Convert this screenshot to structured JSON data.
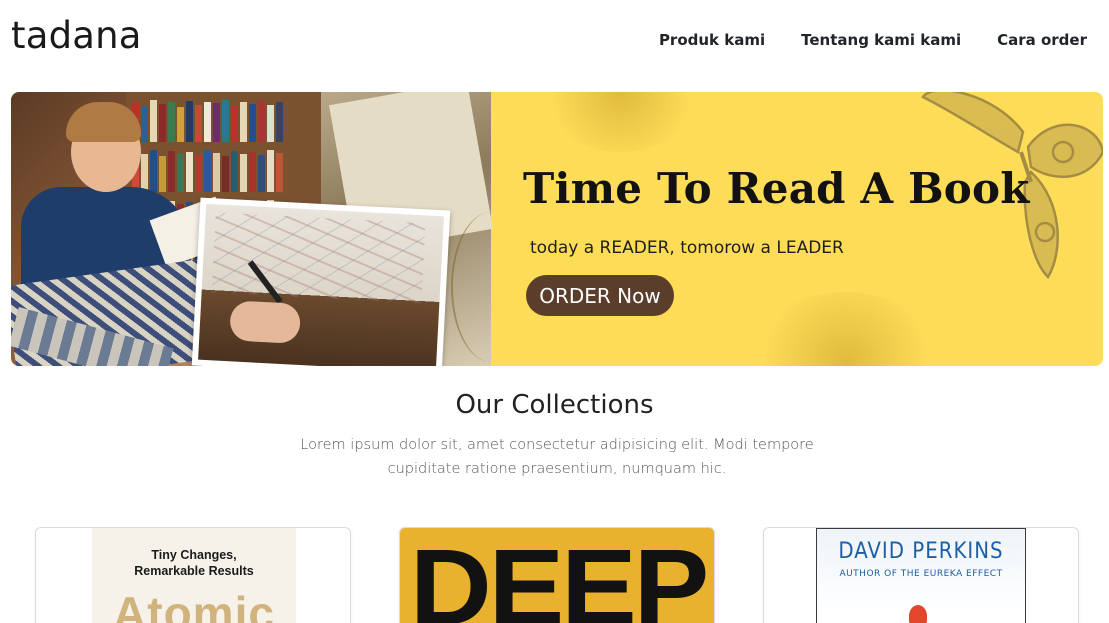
{
  "navbar": {
    "brand": "tadana",
    "links": [
      {
        "label": "Produk kami"
      },
      {
        "label": "Tentang kami kami"
      },
      {
        "label": "Cara order"
      }
    ]
  },
  "hero": {
    "title": "Time To Read A Book",
    "subtitle": "today a READER, tomorow a LEADER",
    "button_label": "ORDER Now",
    "colors": {
      "background": "#fddc58",
      "button": "#5a3d2b"
    }
  },
  "collections": {
    "title": "Our Collections",
    "description": "Lorem ipsum dolor sit, amet consectetur adipisicing elit. Modi tempore cupiditate ratione praesentium, numquam hic.",
    "books": [
      {
        "cover_line1": "Tiny Changes,",
        "cover_line2": "Remarkable Results",
        "cover_title": "Atomic"
      },
      {
        "cover_title": "DEEP"
      },
      {
        "cover_author": "DAVID PERKINS",
        "cover_byline": "AUTHOR OF THE EUREKA EFFECT"
      }
    ]
  }
}
